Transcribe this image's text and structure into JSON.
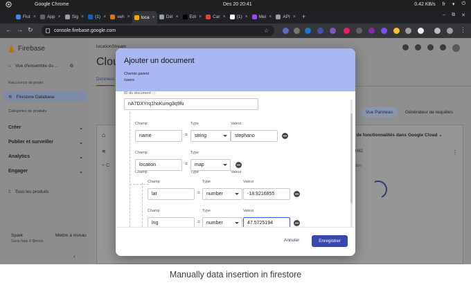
{
  "os_bar": {
    "app_name": "Google Chrome",
    "clock": "Des 20  20:41",
    "net_speed": "0.42 KB/s",
    "lang": "fr"
  },
  "tabs": [
    {
      "label": "Flut",
      "favicon": "#4285f4"
    },
    {
      "label": "App",
      "favicon": "#5f6368"
    },
    {
      "label": "Sig",
      "favicon": "#9aa0a6"
    },
    {
      "label": "(1)",
      "favicon": "#0a66c2"
    },
    {
      "label": "veh",
      "favicon": "#e37400"
    },
    {
      "label": "loca",
      "favicon": "#f9ab00",
      "active": true
    },
    {
      "label": "Dél",
      "favicon": "#9aa0a6"
    },
    {
      "label": "Edi",
      "favicon": "#000000"
    },
    {
      "label": "Car",
      "favicon": "#ea4335"
    },
    {
      "label": "(1)",
      "favicon": "#ffffff"
    },
    {
      "label": "Mei",
      "favicon": "#a142f4"
    },
    {
      "label": "API",
      "favicon": "#9aa0a6"
    }
  ],
  "url": "console.firebase.google.com",
  "sidebar": {
    "brand": "Firebase",
    "overview": "Vue d'ensemble du ...",
    "shortcuts_label": "Raccourcis de projet",
    "firestore": "Firestore Database",
    "categories_label": "Catégories de produits",
    "groups": [
      "Créer",
      "Publier et surveiller",
      "Analytics",
      "Engager"
    ],
    "all_products": "Tous les produits",
    "plan_name": "Spark",
    "plan_desc": "Sans frais 0 $/mois",
    "upgrade": "Mettre à niveau"
  },
  "main": {
    "project": "locationStream",
    "title": "Clou",
    "tab_data": "Données",
    "view_panel": "Vue Panneau",
    "query_builder": "Générateur de requêtes",
    "more_features": "e de fonctionnalités dans Google Cloud",
    "doc_id_frag": "KH82",
    "collection_frag": "ction",
    "add_c": "+ C"
  },
  "modal": {
    "title": "Ajouter un document",
    "parent_label": "Chemin parent",
    "parent_value": "/users",
    "doc_id_label": "ID du document",
    "doc_id": "nA7DXYrq1hoKumg3q9fu",
    "field_label": "Champ",
    "type_label": "Type",
    "value_label": "Valeur",
    "fields": [
      {
        "name": "name",
        "type": "string",
        "value": "stephano"
      },
      {
        "name": "location",
        "type": "map"
      },
      {
        "name": "lat",
        "type": "number",
        "value": "-18.9216855"
      },
      {
        "name": "lng",
        "type": "number",
        "value": "47.5725194"
      }
    ],
    "cancel": "Annuler",
    "save": "Enregistrer"
  },
  "caption": "Manually data insertion in firestore"
}
